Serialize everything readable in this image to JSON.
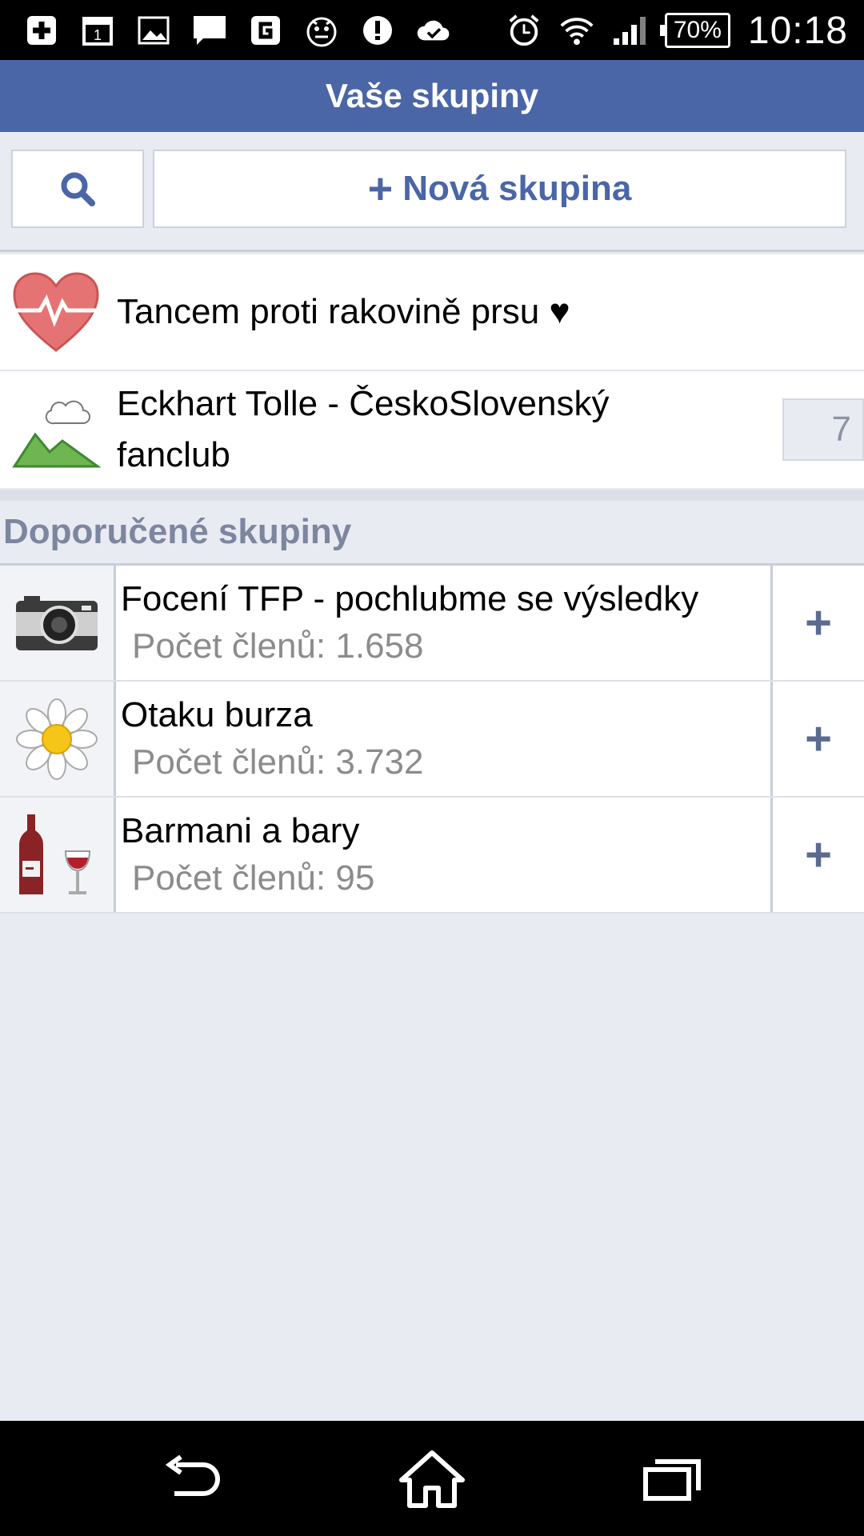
{
  "statusbar": {
    "battery": "70%",
    "time": "10:18",
    "left_icons": [
      "add-icon",
      "calendar-icon",
      "gallery-icon",
      "chat-icon",
      "g-app-icon",
      "mascot-icon",
      "alert-icon",
      "cloud-check-icon"
    ],
    "calendar_day": "1",
    "right_icons": [
      "alarm-icon",
      "wifi-icon",
      "signal-icon",
      "battery-icon"
    ]
  },
  "header": {
    "title": "Vaše skupiny"
  },
  "toolbar": {
    "search_icon": "search-icon",
    "new_group_label": "Nová skupina",
    "new_group_prefix": "+"
  },
  "groups": [
    {
      "name": "Tancem proti rakovině prsu ♥",
      "icon": "heart-icon",
      "badge": ""
    },
    {
      "name": "Eckhart Tolle - ČeskoSlovenský fanclub",
      "icon": "landscape-icon",
      "badge": "7"
    }
  ],
  "suggested": {
    "title": "Doporučené skupiny",
    "items": [
      {
        "name": "Focení TFP - pochlubme se výsledky",
        "count": "Počet členů: 1.658",
        "icon": "camera-icon",
        "join": "+"
      },
      {
        "name": "Otaku burza",
        "count": "Počet členů: 3.732",
        "icon": "flower-icon",
        "join": "+"
      },
      {
        "name": "Barmani a bary",
        "count": "Počet členů: 95",
        "icon": "wine-icon",
        "join": "+"
      }
    ]
  },
  "navbar": [
    "back-icon",
    "home-icon",
    "recent-apps-icon"
  ],
  "colors": {
    "accent": "#4a66a7",
    "background": "#e9ebf2",
    "muted": "#7d869f"
  }
}
